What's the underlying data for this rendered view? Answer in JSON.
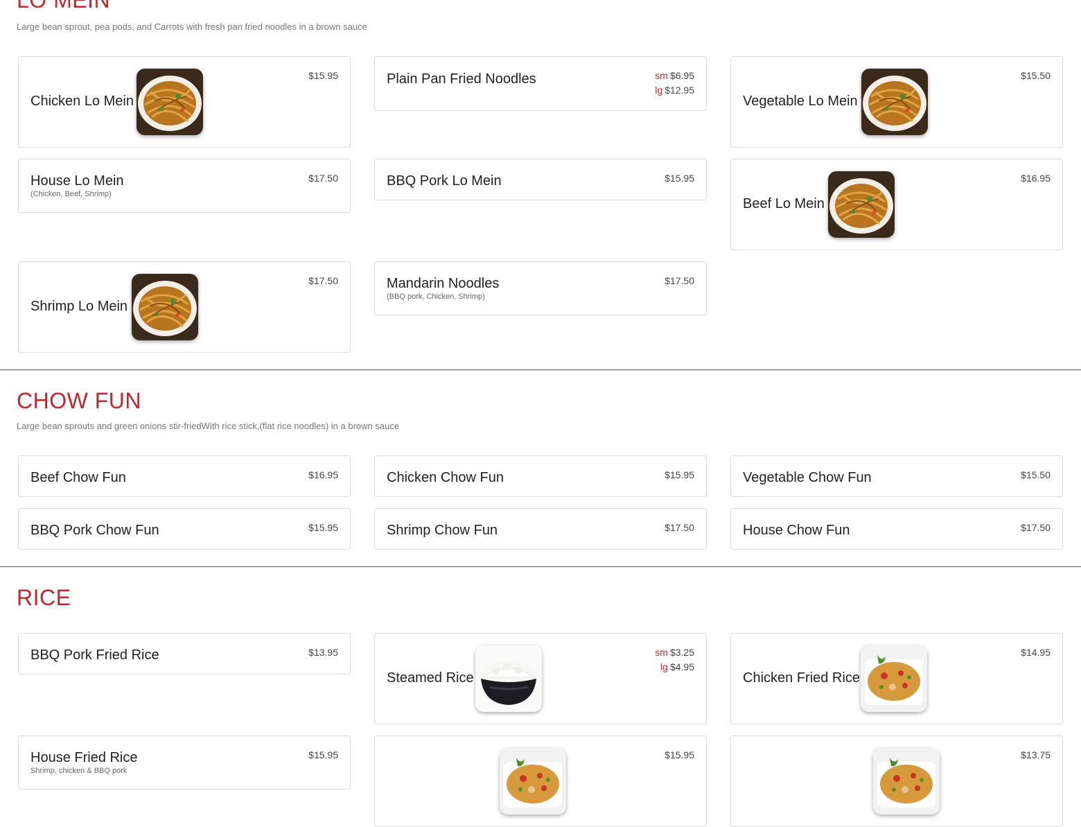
{
  "sections": {
    "lo_mein": {
      "title": "LO MEIN",
      "description": "Large bean sprout, pea pods, and Carrots with fresh pan fried noodles in a brown sauce",
      "items": [
        {
          "name": "Chicken Lo Mein",
          "price": "$15.95",
          "image": "noodles-photo"
        },
        {
          "name": "Plain Pan Fried Noodles",
          "sm_label": "sm",
          "sm_price": "$6.95",
          "lg_label": "lg",
          "lg_price": "$12.95"
        },
        {
          "name": "Vegetable Lo Mein",
          "price": "$15.50",
          "image": "noodles-photo"
        },
        {
          "name": "House Lo Mein",
          "note": "(Chicken, Beef, Shrimp)",
          "price": "$17.50"
        },
        {
          "name": "BBQ Pork Lo Mein",
          "price": "$15.95"
        },
        {
          "name": "Beef Lo Mein",
          "price": "$16.95",
          "image": "noodles-photo"
        },
        {
          "name": "Shrimp Lo Mein",
          "price": "$17.50",
          "image": "noodles-photo"
        },
        {
          "name": "Mandarin Noodles",
          "note": "(BBQ pork, Chicken, Shrimp)",
          "price": "$17.50"
        }
      ]
    },
    "chow_fun": {
      "title": "CHOW FUN",
      "description": "Large bean sprouts and green onions stir-friedWith rice stick,(flat rice noodles) in a brown sauce",
      "items": [
        {
          "name": "Beef Chow Fun",
          "price": "$16.95"
        },
        {
          "name": "Chicken Chow Fun",
          "price": "$15.95"
        },
        {
          "name": "Vegetable Chow Fun",
          "price": "$15.50"
        },
        {
          "name": "BBQ Pork Chow Fun",
          "price": "$15.95"
        },
        {
          "name": "Shrimp Chow Fun",
          "price": "$17.50"
        },
        {
          "name": "House Chow Fun",
          "price": "$17.50"
        }
      ]
    },
    "rice": {
      "title": "RICE",
      "items": [
        {
          "name": "BBQ Pork Fried Rice",
          "price": "$13.95"
        },
        {
          "name": "Steamed Rice",
          "sm_label": "sm",
          "sm_price": "$3.25",
          "lg_label": "lg",
          "lg_price": "$4.95",
          "image": "rice-bowl-photo"
        },
        {
          "name": "Chicken Fried Rice",
          "price": "$14.95",
          "image": "fried-rice-photo"
        },
        {
          "name": "House Fried Rice",
          "note": "Shrimp, chicken & BBQ pork",
          "price": "$15.95"
        },
        {
          "name": "",
          "price": "$15.95",
          "image": "fried-rice-photo"
        },
        {
          "name": "",
          "price": "$13.75",
          "image": "fried-rice-photo"
        }
      ]
    }
  },
  "colors": {
    "accent": "#c4262e",
    "card_border": "#dcdcdc",
    "text": "#222222",
    "muted": "#777777"
  }
}
